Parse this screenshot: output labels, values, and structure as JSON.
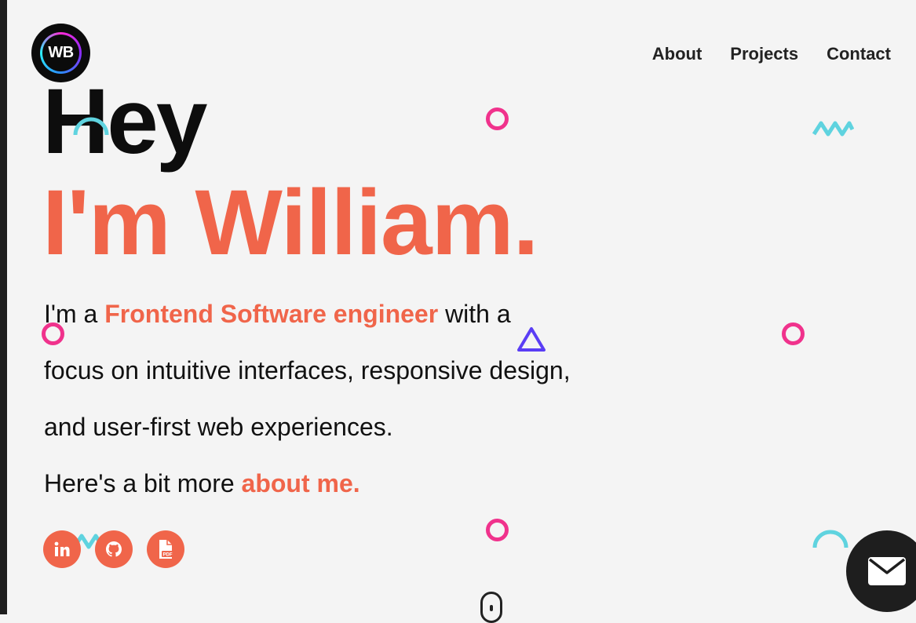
{
  "logo": {
    "text": "WB"
  },
  "nav": {
    "items": [
      "About",
      "Projects",
      "Contact"
    ]
  },
  "hero": {
    "greeting": "Hey",
    "name": "I'm William.",
    "intro": {
      "prefix": "I'm a ",
      "role": "Frontend Software engineer",
      "suffix": " with a focus on intuitive interfaces, responsive design, and user-first web experiences.",
      "more_prefix": "Here's a bit more ",
      "more_link": "about me."
    }
  },
  "social": [
    {
      "icon": "linkedin-icon"
    },
    {
      "icon": "github-icon"
    },
    {
      "icon": "pdf-resume-icon",
      "label": "PDF"
    }
  ],
  "colors": {
    "accent": "#f0654a",
    "dark": "#1e1e1e",
    "background": "#f4f4f4",
    "deco_pink": "#f0328c",
    "deco_cyan": "#5fd3df",
    "deco_purple": "#5a3df5"
  },
  "contact_button": {
    "icon": "mail-icon"
  },
  "scroll_indicator": {
    "icon": "mouse-scroll-icon"
  }
}
